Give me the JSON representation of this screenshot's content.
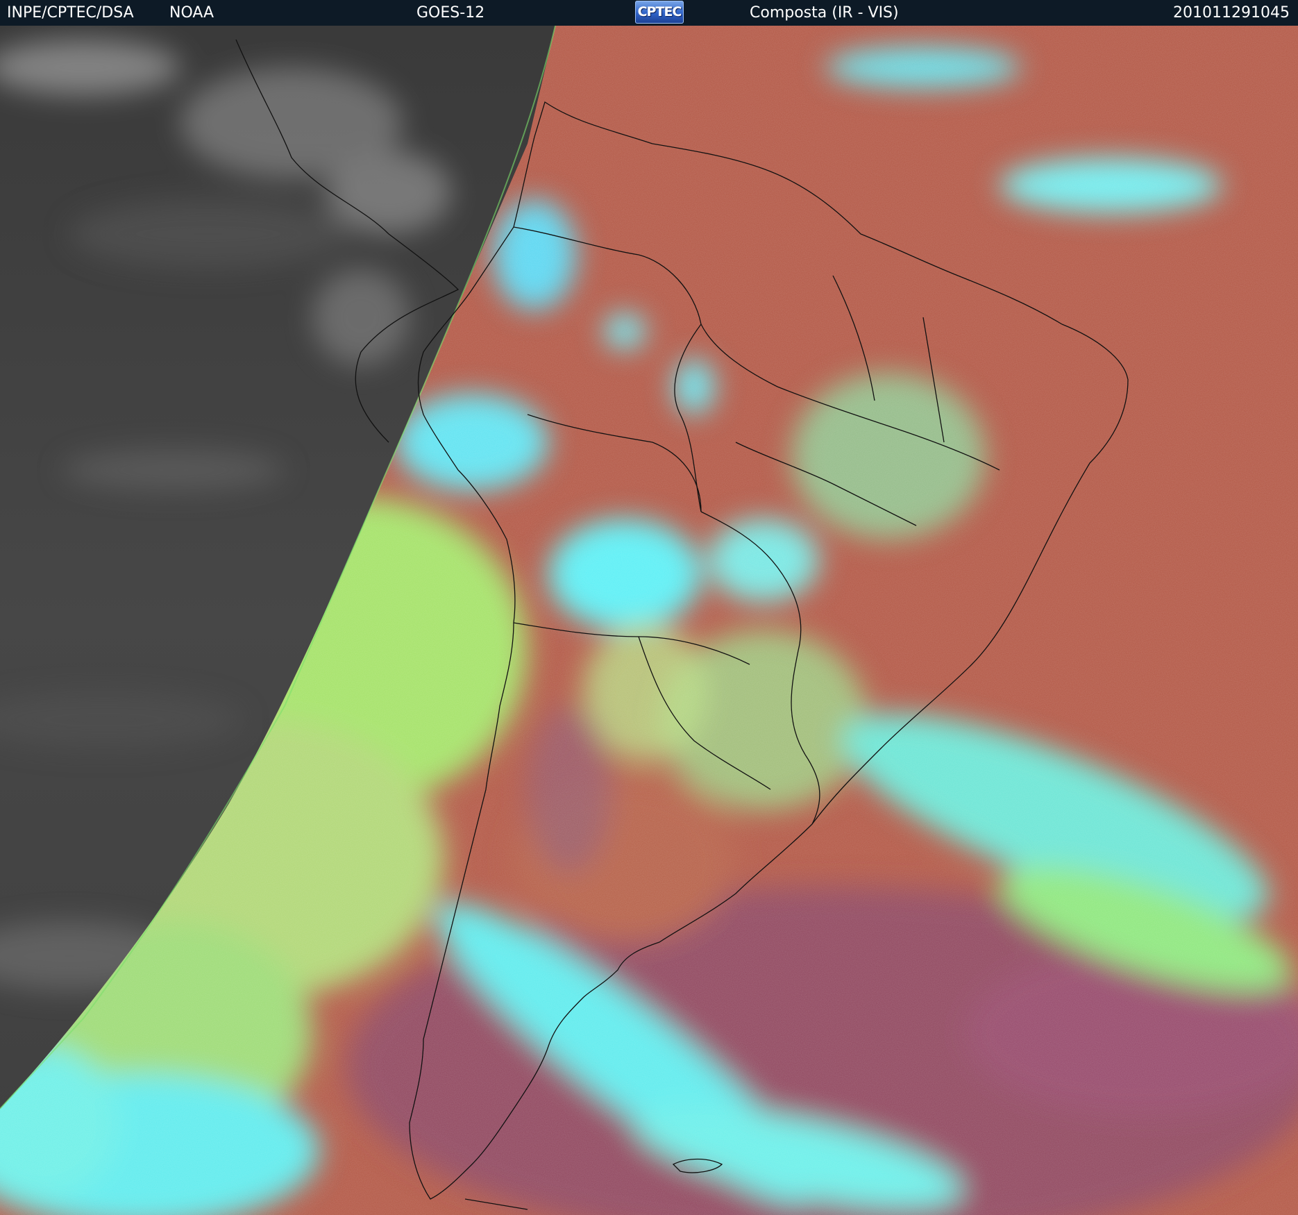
{
  "header": {
    "institution": "INPE/CPTEC/DSA",
    "agency": "NOAA",
    "satellite": "GOES-12",
    "logo_text": "CPTEC",
    "product": "Composta (IR - VIS)",
    "timestamp": "201011291045"
  },
  "colors": {
    "header_bg": "#0d1a26",
    "header_text": "#ffffff",
    "night_gray": "#4a4a4a",
    "land_red": "#b35a4a",
    "cloud_cyan": "#5ff0f4",
    "cloud_green": "#98e86a",
    "ocean_purple": "#8e4a66"
  }
}
